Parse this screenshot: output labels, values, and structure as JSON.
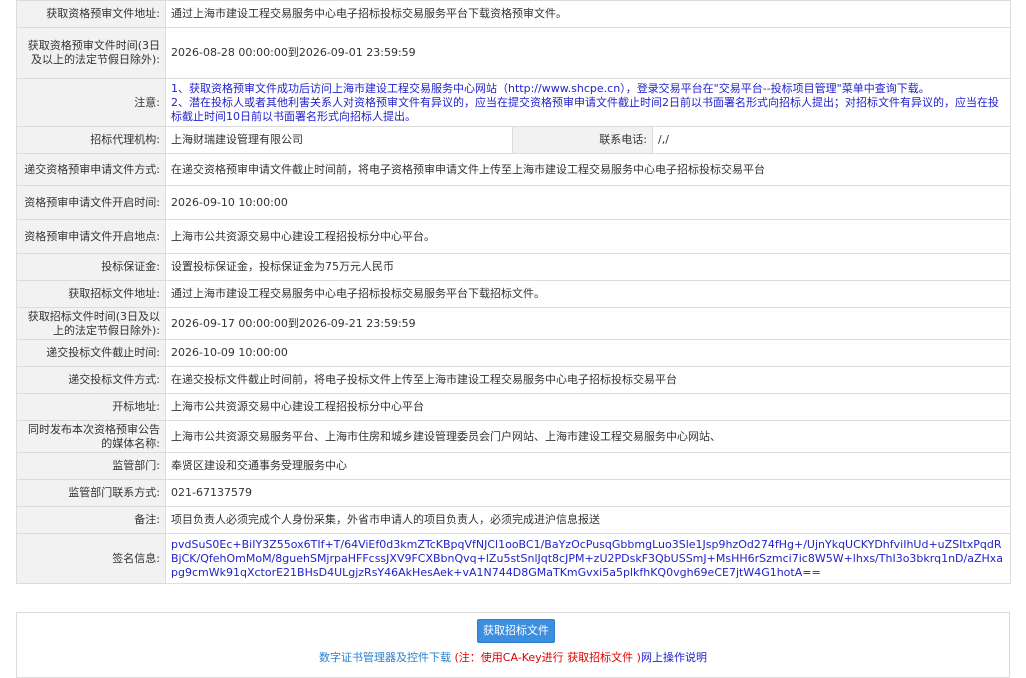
{
  "rows": [
    {
      "label": "获取资格预审文件地址:",
      "value": "通过上海市建设工程交易服务中心电子招标投标交易服务平台下载资格预审文件。"
    },
    {
      "label": "获取资格预审文件时间(3日及以上的法定节假日除外):",
      "value": "2026-08-28 00:00:00到2026-09-01 23:59:59"
    },
    {
      "label": "注意:",
      "value_lines": [
        "1、获取资格预审文件成功后访问上海市建设工程交易服务中心网站（http://www.shcpe.cn），登录交易平台在\"交易平台--投标项目管理\"菜单中查询下载。",
        "2、潜在投标人或者其他利害关系人对资格预审文件有异议的，应当在提交资格预审申请文件截止时间2日前以书面署名形式向招标人提出；对招标文件有异议的，应当在投标截止时间10日前以书面署名形式向招标人提出。"
      ]
    },
    {
      "label": "招标代理机构:",
      "value": "上海财瑞建设管理有限公司",
      "label2": "联系电话:",
      "value2": "/,/"
    },
    {
      "label": "递交资格预审申请文件方式:",
      "value": "在递交资格预审申请文件截止时间前，将电子资格预审申请文件上传至上海市建设工程交易服务中心电子招标投标交易平台"
    },
    {
      "label": "资格预审申请文件开启时间:",
      "value": "2026-09-10 10:00:00"
    },
    {
      "label": "资格预审申请文件开启地点:",
      "value": "上海市公共资源交易中心建设工程招投标分中心平台。"
    },
    {
      "label": "投标保证金:",
      "value": "设置投标保证金，投标保证金为75万元人民币"
    },
    {
      "label": "获取招标文件地址:",
      "value": "通过上海市建设工程交易服务中心电子招标投标交易服务平台下载招标文件。"
    },
    {
      "label": "获取招标文件时间(3日及以上的法定节假日除外):",
      "value": "2026-09-17 00:00:00到2026-09-21 23:59:59"
    },
    {
      "label": "递交投标文件截止时间:",
      "value": "2026-10-09 10:00:00"
    },
    {
      "label": "递交投标文件方式:",
      "value": "在递交投标文件截止时间前，将电子投标文件上传至上海市建设工程交易服务中心电子招标投标交易平台"
    },
    {
      "label": "开标地址:",
      "value": "上海市公共资源交易中心建设工程招投标分中心平台"
    },
    {
      "label": "同时发布本次资格预审公告的媒体名称:",
      "value": "上海市公共资源交易服务平台、上海市住房和城乡建设管理委员会门户网站、上海市建设工程交易服务中心网站、"
    },
    {
      "label": "监管部门:",
      "value": "奉贤区建设和交通事务受理服务中心"
    },
    {
      "label": "监管部门联系方式:",
      "value": "021-67137579"
    },
    {
      "label": "备注:",
      "value": "项目负责人必须完成个人身份采集，外省市申请人的项目负责人，必须完成进沪信息报送"
    },
    {
      "label": "签名信息:",
      "value": "pvdSuS0Ec+BiIY3Z55ox6TIf+T/64ViEf0d3kmZTcKBpqVfNJCl1ooBC1/BaYzOcPusqGbbmgLuo3Sle1Jsp9hzOd274fHg+/UjnYkqUCKYDhfviIhUd+uZSItxPqdRBjCK/QfehOmMoM/8guehSMjrpaHFFcssJXV9FCXBbnQvq+lZu5stSnlJqt8cJPM+zU2PDskF3QbUSSmJ+MsHH6rSzmci7ic8W5W+lhxs/ThI3o3bkrq1nD/aZHxapg9cmWk91qXctorE21BHsD4ULgjzRsY46AkHesAek+vA1N744D8GMaTKmGvxi5a5plkfhKQ0vgh69eCE7jtW4G1hotA=="
    }
  ],
  "bottom": {
    "button_label": "获取招标文件",
    "link_cert": "数字证书管理器及控件下载",
    "note_open": " (注：使用CA-Key进行 ",
    "note_link": "获取招标文件",
    "note_close": " )",
    "link_help": "网上操作说明"
  }
}
